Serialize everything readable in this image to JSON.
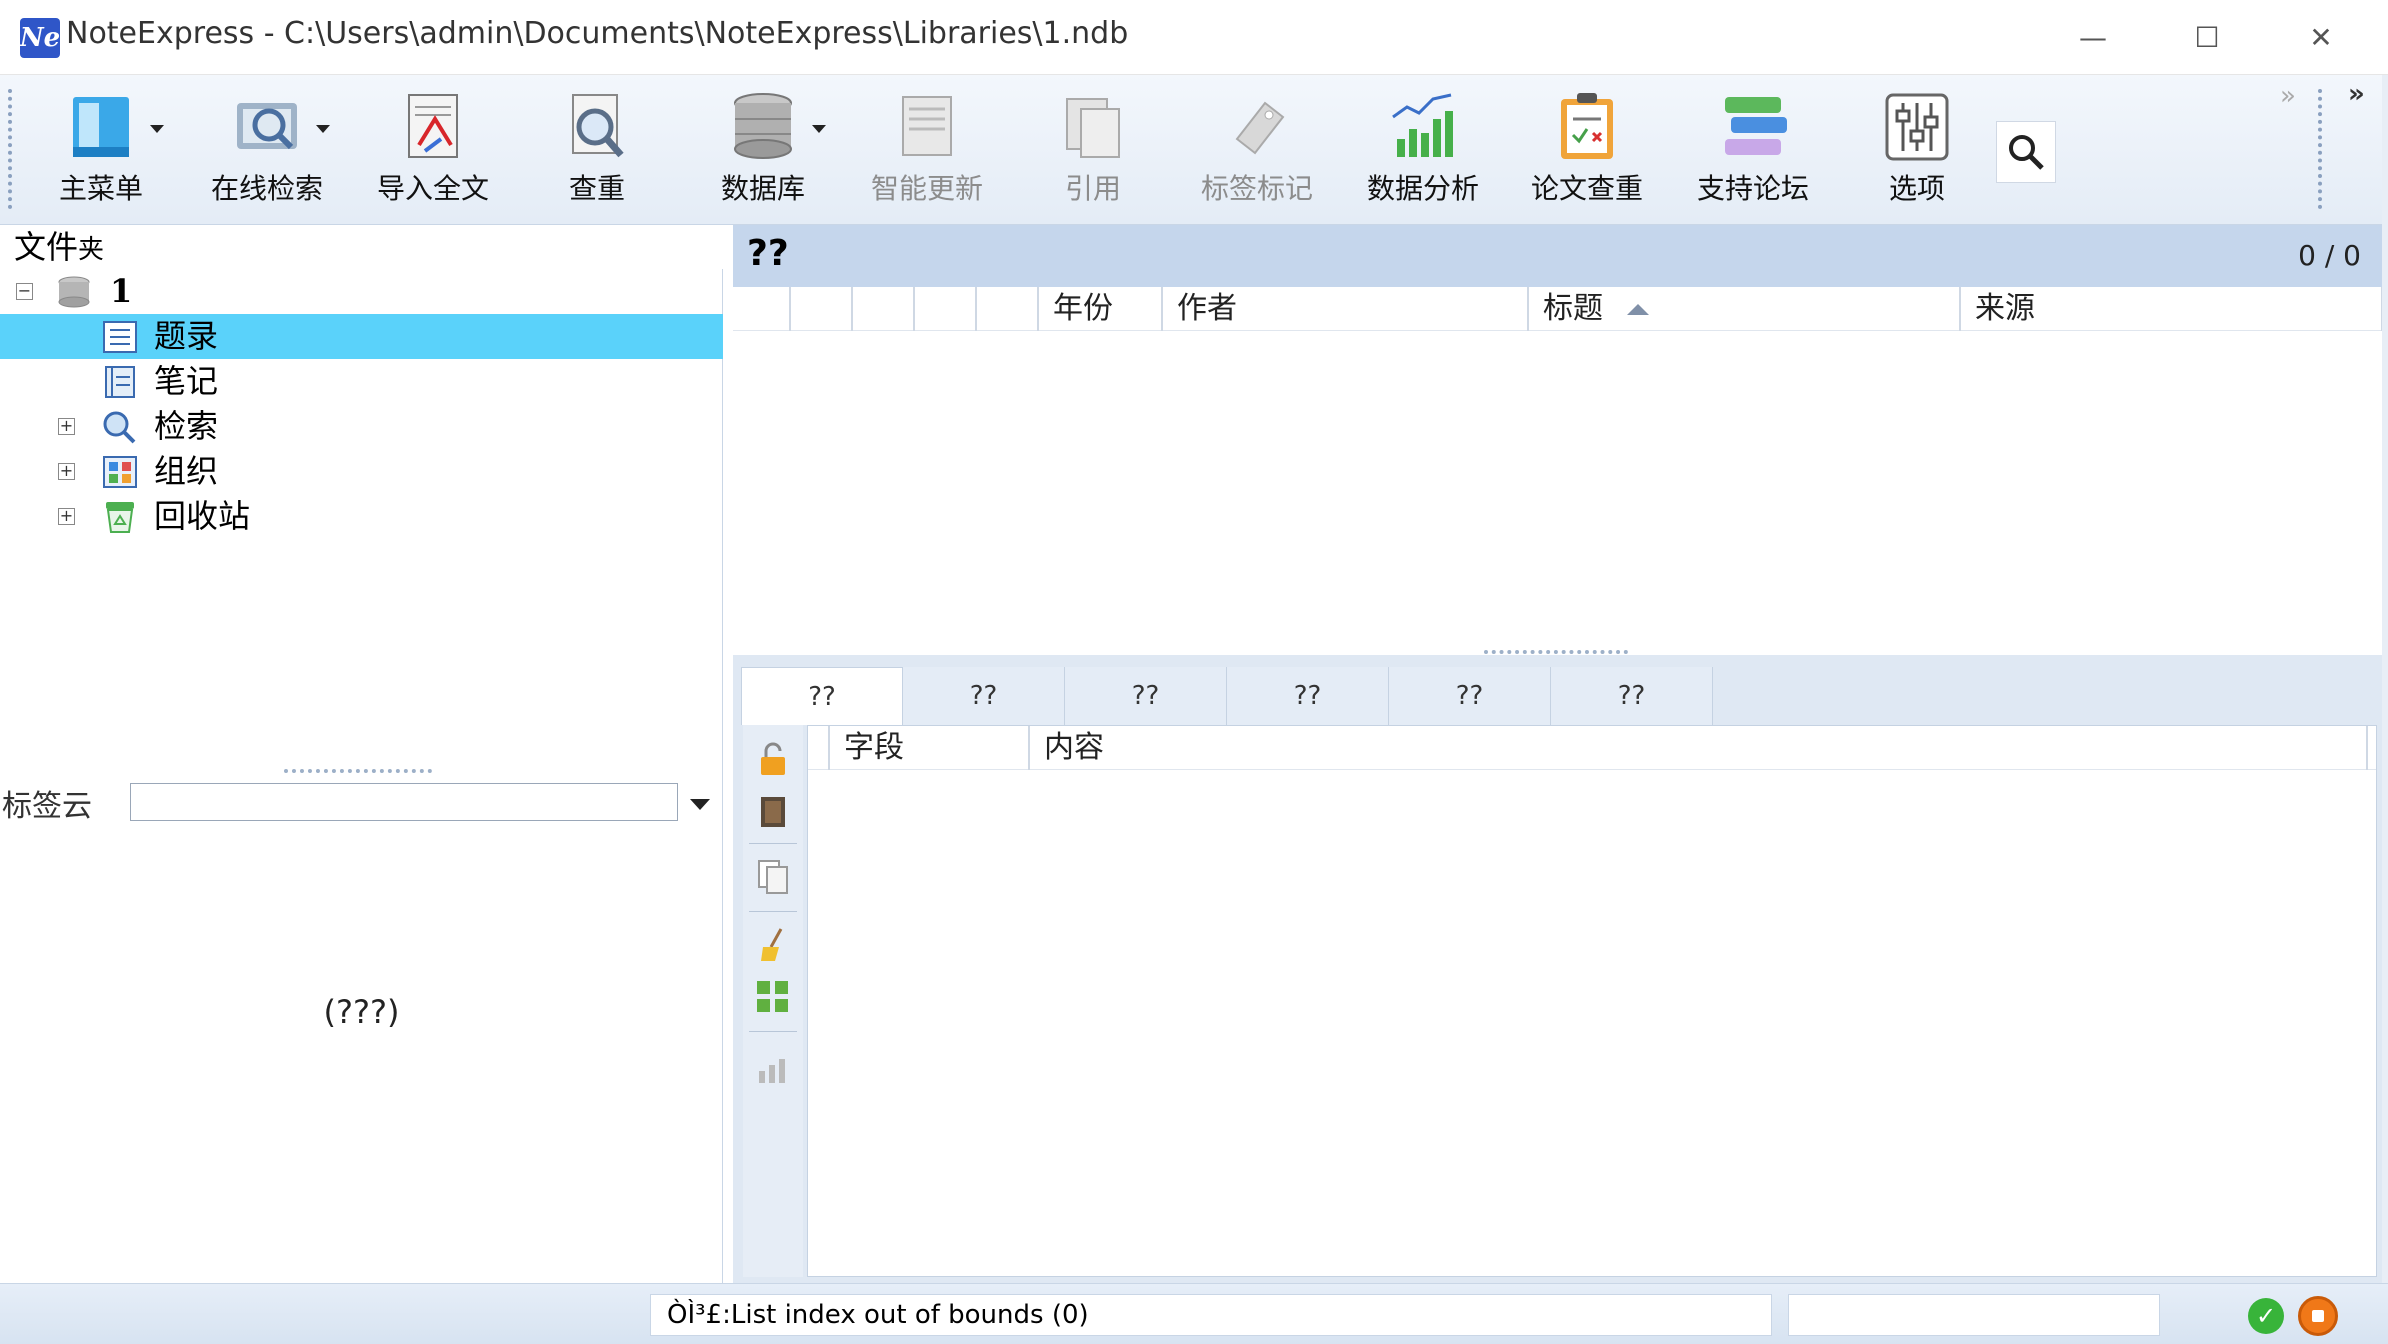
{
  "window": {
    "app_logo_text": "Ne",
    "title": "NoteExpress - C:\\Users\\admin\\Documents\\NoteExpress\\Libraries\\1.ndb",
    "minimize_glyph": "—",
    "maximize_glyph": "☐",
    "close_glyph": "✕"
  },
  "toolbar": {
    "buttons": [
      {
        "label": "主菜单",
        "icon": "main-menu-icon"
      },
      {
        "label": "在线检索",
        "icon": "online-search-icon"
      },
      {
        "label": "导入全文",
        "icon": "import-fulltext-icon"
      },
      {
        "label": "查重",
        "icon": "duplicate-check-icon"
      },
      {
        "label": "数据库",
        "icon": "database-icon"
      },
      {
        "label": "智能更新",
        "icon": "smart-update-icon"
      },
      {
        "label": "引用",
        "icon": "cite-icon"
      },
      {
        "label": "标签标记",
        "icon": "tag-mark-icon"
      },
      {
        "label": "数据分析",
        "icon": "data-analysis-icon"
      },
      {
        "label": "论文查重",
        "icon": "paper-check-icon"
      },
      {
        "label": "支持论坛",
        "icon": "support-forum-icon"
      },
      {
        "label": "选项",
        "icon": "options-icon"
      }
    ],
    "overflow_glyph": "»"
  },
  "folders": {
    "header_main": "文件",
    "header_small": "夹",
    "tree": [
      {
        "label": "1",
        "expander": "−",
        "icon": "database-icon"
      },
      {
        "label": "题录",
        "icon": "references-icon"
      },
      {
        "label": "笔记",
        "icon": "notes-icon"
      },
      {
        "label": "检索",
        "expander": "+",
        "icon": "search-icon"
      },
      {
        "label": "组织",
        "expander": "+",
        "icon": "organize-icon"
      },
      {
        "label": "回收站",
        "expander": "+",
        "icon": "recycle-bin-icon"
      }
    ]
  },
  "tag_cloud": {
    "label": "标签云",
    "input_value": "",
    "empty_text": "(???)"
  },
  "list": {
    "title": "??",
    "count": "0 / 0",
    "columns": [
      "年份",
      "作者",
      "标题",
      "来源"
    ]
  },
  "detail": {
    "tabs": [
      "??",
      "??",
      "??",
      "??",
      "??",
      "??"
    ],
    "field_columns": [
      "字段",
      "内容"
    ]
  },
  "status": {
    "message": "ÒÌ³£:List index out of bounds (0)",
    "ok_glyph": "✓"
  }
}
